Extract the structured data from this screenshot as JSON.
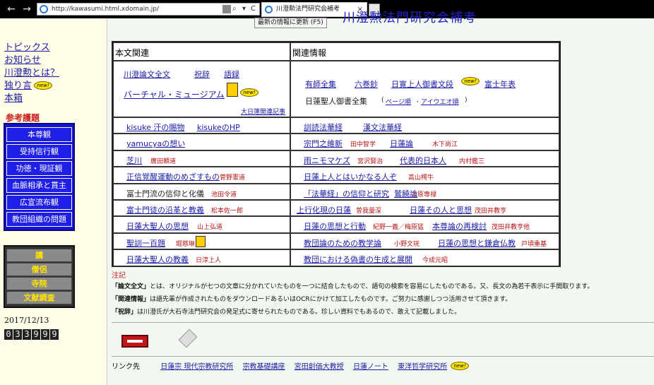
{
  "browser": {
    "url": "http://kawasumi.html.xdomain.jp/",
    "tab_title": "川澄勲法門研究会補考",
    "tooltip": "最新の情報に更新 (F5)",
    "back_glyph": "←",
    "forward_glyph": "→",
    "search_glyph": "⌕",
    "refresh_glyph": "C",
    "close_glyph": "×"
  },
  "site_title": "川澄勲法門研究会補考",
  "left_nav": [
    {
      "label": "トピックス"
    },
    {
      "label": "お知らせ"
    },
    {
      "label": "川澄勲とは？"
    },
    {
      "label": "独り言",
      "badge": "new!"
    },
    {
      "label": "本箱"
    }
  ],
  "reference": {
    "heading": "参考護題",
    "items": [
      "本尊観",
      "受持信行観",
      "功徳・現証観",
      "血脈相承と貫主",
      "広宣流布観",
      "教団組織の問題"
    ]
  },
  "grey_menu": [
    "講",
    "僧侶",
    "寺院",
    "文献調査"
  ],
  "date": "2017/12/13",
  "counter": [
    "0",
    "3",
    "3",
    "9",
    "9",
    "9"
  ],
  "table": {
    "header_left": "本文関連",
    "header_right": "関連情報",
    "top_left": {
      "line1": [
        "川澄論文全文",
        "祝辞",
        "語録"
      ],
      "line2": "バーチャル・ミュージアム",
      "badge": "new!",
      "sub": "大日蓮関連記事"
    },
    "top_right": {
      "line1": [
        "有師全集",
        "六巻鈔",
        "日寛上人御書文段",
        "富士年表"
      ],
      "badge": "new!",
      "line2_text": "日蓮聖人御書全集",
      "line2_links": [
        "ページ順",
        "アイウエオ順"
      ]
    },
    "rows": [
      {
        "left": [
          {
            "t": "kisuke 汗の賜物",
            "k": "a"
          },
          {
            "t": "kisukeのHP",
            "k": "a"
          }
        ],
        "right": [
          {
            "t": "訓読法華経",
            "k": "a"
          },
          {
            "t": "漢文法華経",
            "k": "a"
          }
        ]
      },
      {
        "left": [
          {
            "t": "yamucyaの想い",
            "k": "a"
          }
        ],
        "right": [
          {
            "t": "宗門之維新",
            "k": "a"
          },
          {
            "t": "田中智学",
            "k": "s"
          },
          {
            "t": "日蓮論",
            "k": "a"
          },
          {
            "t": "木下尚江",
            "k": "s"
          }
        ]
      },
      {
        "left": [
          {
            "t": "芝川",
            "k": "a"
          },
          {
            "t": "廣田頼道",
            "k": "s"
          }
        ],
        "right": [
          {
            "t": "雨ニモマケズ",
            "k": "a"
          },
          {
            "t": "宮沢賢治",
            "k": "s"
          },
          {
            "t": "代表的日本人",
            "k": "a"
          },
          {
            "t": "内村鑑三",
            "k": "s"
          }
        ]
      },
      {
        "left": [
          {
            "t": "正信覚醒運動のめざすもの",
            "k": "a"
          },
          {
            "t": "菅野憲道",
            "k": "s"
          }
        ],
        "right": [
          {
            "t": "日蓮上人とはいかなる人ぞ",
            "k": "a"
          },
          {
            "t": "高山樗牛",
            "k": "s"
          }
        ]
      },
      {
        "left": [
          {
            "t": "冨士門流の信仰と化儀",
            "k": "t"
          },
          {
            "t": "池田令道",
            "k": "s"
          }
        ],
        "right": [
          {
            "t": "「法華経」の信仰と研究",
            "k": "a"
          },
          {
            "t": "鷲饒論",
            "k": "a"
          },
          {
            "t": "上原専禄",
            "k": "s"
          }
        ]
      },
      {
        "left": [
          {
            "t": "富士門徒の沿革と教義",
            "k": "a"
          },
          {
            "t": "松本佐一郎",
            "k": "s"
          }
        ],
        "right": [
          {
            "t": "上行化現の日蓮",
            "k": "a"
          },
          {
            "t": "曽我量深",
            "k": "s"
          },
          {
            "t": "日蓮その人と思想",
            "k": "a"
          },
          {
            "t": "茂田井教亨",
            "k": "s"
          }
        ]
      },
      {
        "left": [
          {
            "t": "日蓮大聖人の思想",
            "k": "a"
          },
          {
            "t": "山上弘道",
            "k": "s"
          }
        ],
        "right": [
          {
            "t": "日蓮の思想と行動",
            "k": "a"
          },
          {
            "t": "紀野一義／梅原猛",
            "k": "s"
          },
          {
            "t": "本尊論の再検討",
            "k": "a"
          },
          {
            "t": "茂田井教亨他",
            "k": "s"
          }
        ]
      },
      {
        "left": [
          {
            "t": "聖訓一百題",
            "k": "a"
          },
          {
            "t": "堀慈琳",
            "k": "s"
          }
        ],
        "right": [
          {
            "t": "教団論のための教学論",
            "k": "a"
          },
          {
            "t": "小野文珖",
            "k": "s"
          },
          {
            "t": "日蓮の思想と鎌倉仏教",
            "k": "a"
          },
          {
            "t": "戸頃重基",
            "k": "s"
          }
        ]
      },
      {
        "left": [
          {
            "t": "日蓮大聖人の教義",
            "k": "a"
          },
          {
            "t": "日淳上人",
            "k": "s"
          }
        ],
        "right": [
          {
            "t": "教団における偽書の生成と展開",
            "k": "a"
          },
          {
            "t": "今成元昭",
            "k": "s"
          }
        ]
      }
    ]
  },
  "notes": {
    "heading": "注記",
    "items": [
      {
        "key": "「論文全文」",
        "text": "とは、オリジナルが七つの文章に分かれていたものを一つに結合したもので、語句の検索を容易にしたものである。又、長文の為若干表示に手間取ります。"
      },
      {
        "key": "「関連情報」",
        "text": "は語先輩が作成されたものをダウンロードあるいはOCRにかけて加工したものです。ご努力に感謝しつつ活用させて頂きます。"
      },
      {
        "key": "「祝辞」",
        "text": "は川澄氏が大石寺法門研究会の発足式に寄せられたものである。珍しい資料でもあるので、敢えて記載しました。"
      }
    ]
  },
  "links": {
    "label": "リンク先",
    "items": [
      "日蓮宗 現代宗教研究所",
      "宗教基礎講座",
      "宮田創価大教授",
      "日蓮ノート",
      "東洋哲学研究所"
    ],
    "badge": "new!"
  }
}
